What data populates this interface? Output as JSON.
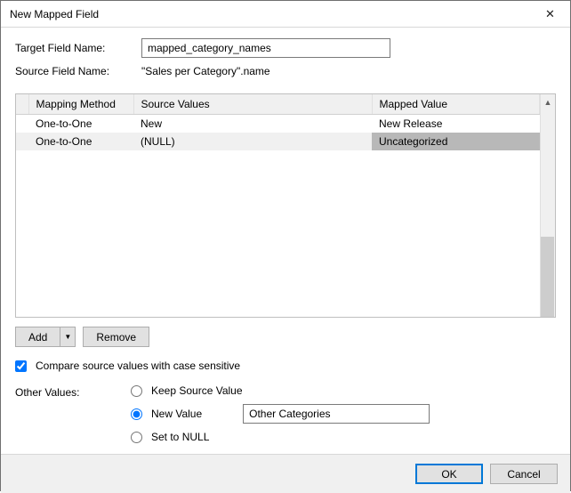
{
  "window": {
    "title": "New Mapped Field"
  },
  "fields": {
    "target_label": "Target Field Name:",
    "target_value": "mapped_category_names",
    "source_label": "Source Field Name:",
    "source_value": "\"Sales per Category\".name"
  },
  "table": {
    "headers": {
      "mm": "Mapping Method",
      "sv": "Source Values",
      "mv": "Mapped Value"
    },
    "rows": [
      {
        "mm": "One-to-One",
        "sv": "New",
        "mv": "New Release",
        "selected": false
      },
      {
        "mm": "One-to-One",
        "sv": "(NULL)",
        "mv": "Uncategorized",
        "selected": true
      }
    ]
  },
  "buttons": {
    "add": "Add",
    "remove": "Remove",
    "ok": "OK",
    "cancel": "Cancel"
  },
  "checkbox": {
    "compare_label": "Compare source values with case sensitive",
    "compare_checked": true
  },
  "other": {
    "label": "Other Values:",
    "opt_keep": "Keep Source Value",
    "opt_new": "New Value",
    "opt_null": "Set to NULL",
    "selected": "new",
    "new_value": "Other Categories"
  }
}
